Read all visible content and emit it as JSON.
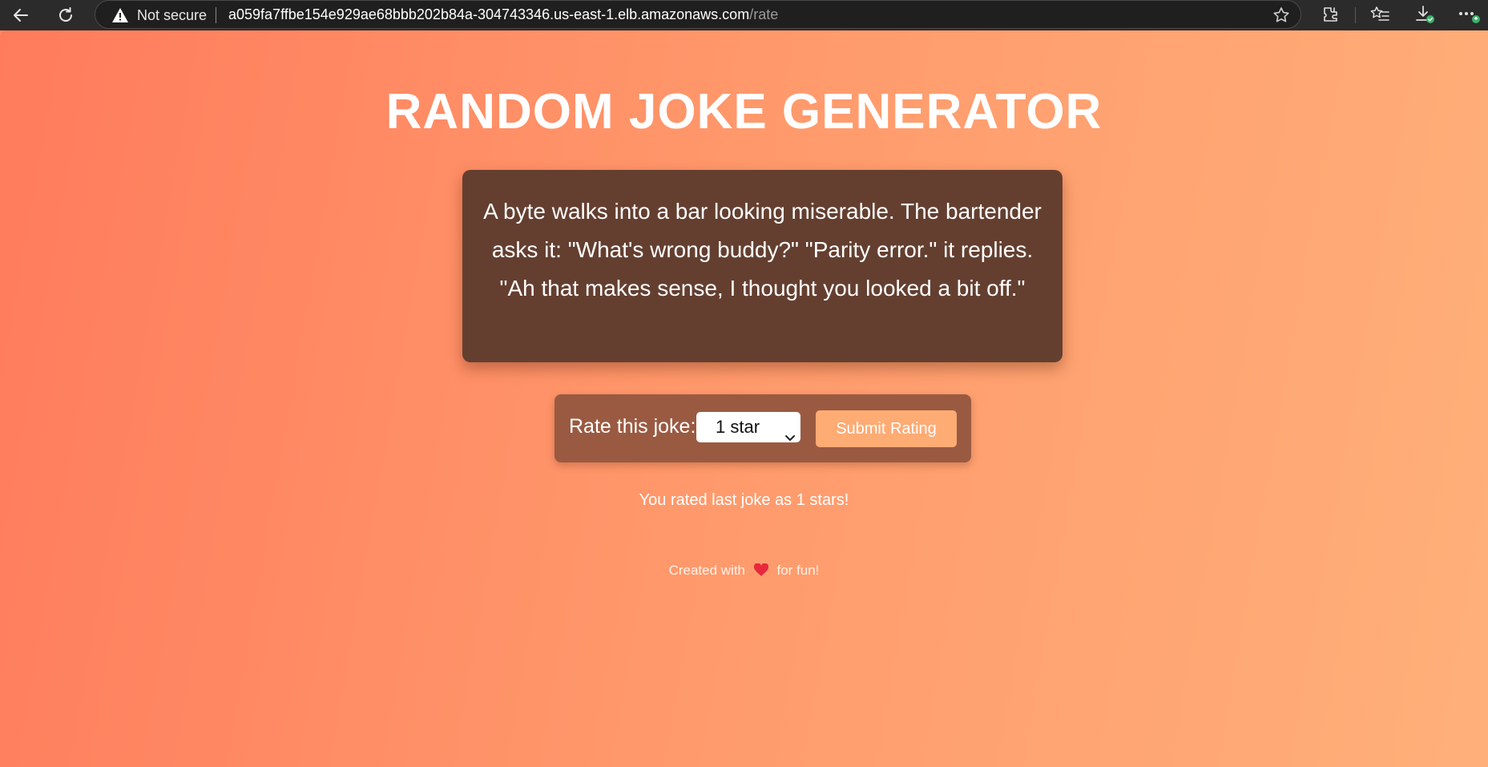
{
  "browser": {
    "security_label": "Not secure",
    "url_host": "a059fa7ffbe154e929ae68bbb202b84a-304743346.us-east-1.elb.amazonaws.com",
    "url_path": "/rate",
    "icons": [
      "back-arrow-icon",
      "reload-icon",
      "warning-icon",
      "favorite-star-icon",
      "extensions-icon",
      "favorites-icon",
      "downloads-icon",
      "more-menu-icon"
    ]
  },
  "page": {
    "title": "RANDOM JOKE GENERATOR",
    "joke": "A byte walks into a bar looking miserable. The bartender asks it: \"What's wrong buddy?\" \"Parity error.\" it replies. \"Ah that makes sense, I thought you looked a bit off.\"",
    "rating": {
      "label": "Rate this joke:",
      "selected_option": "1 star",
      "submit_label": "Submit Rating"
    },
    "rated_message": "You rated last joke as 1 stars!",
    "footer": {
      "prefix": "Created with",
      "suffix": "for fun!",
      "icon": "heart-icon"
    }
  },
  "colors": {
    "gradient_start": "#ff7b5c",
    "gradient_end": "#ffb07a",
    "card_bg": "#643f30",
    "rate_box_bg": "#9a5a42",
    "submit_bg": "#ffab74"
  }
}
